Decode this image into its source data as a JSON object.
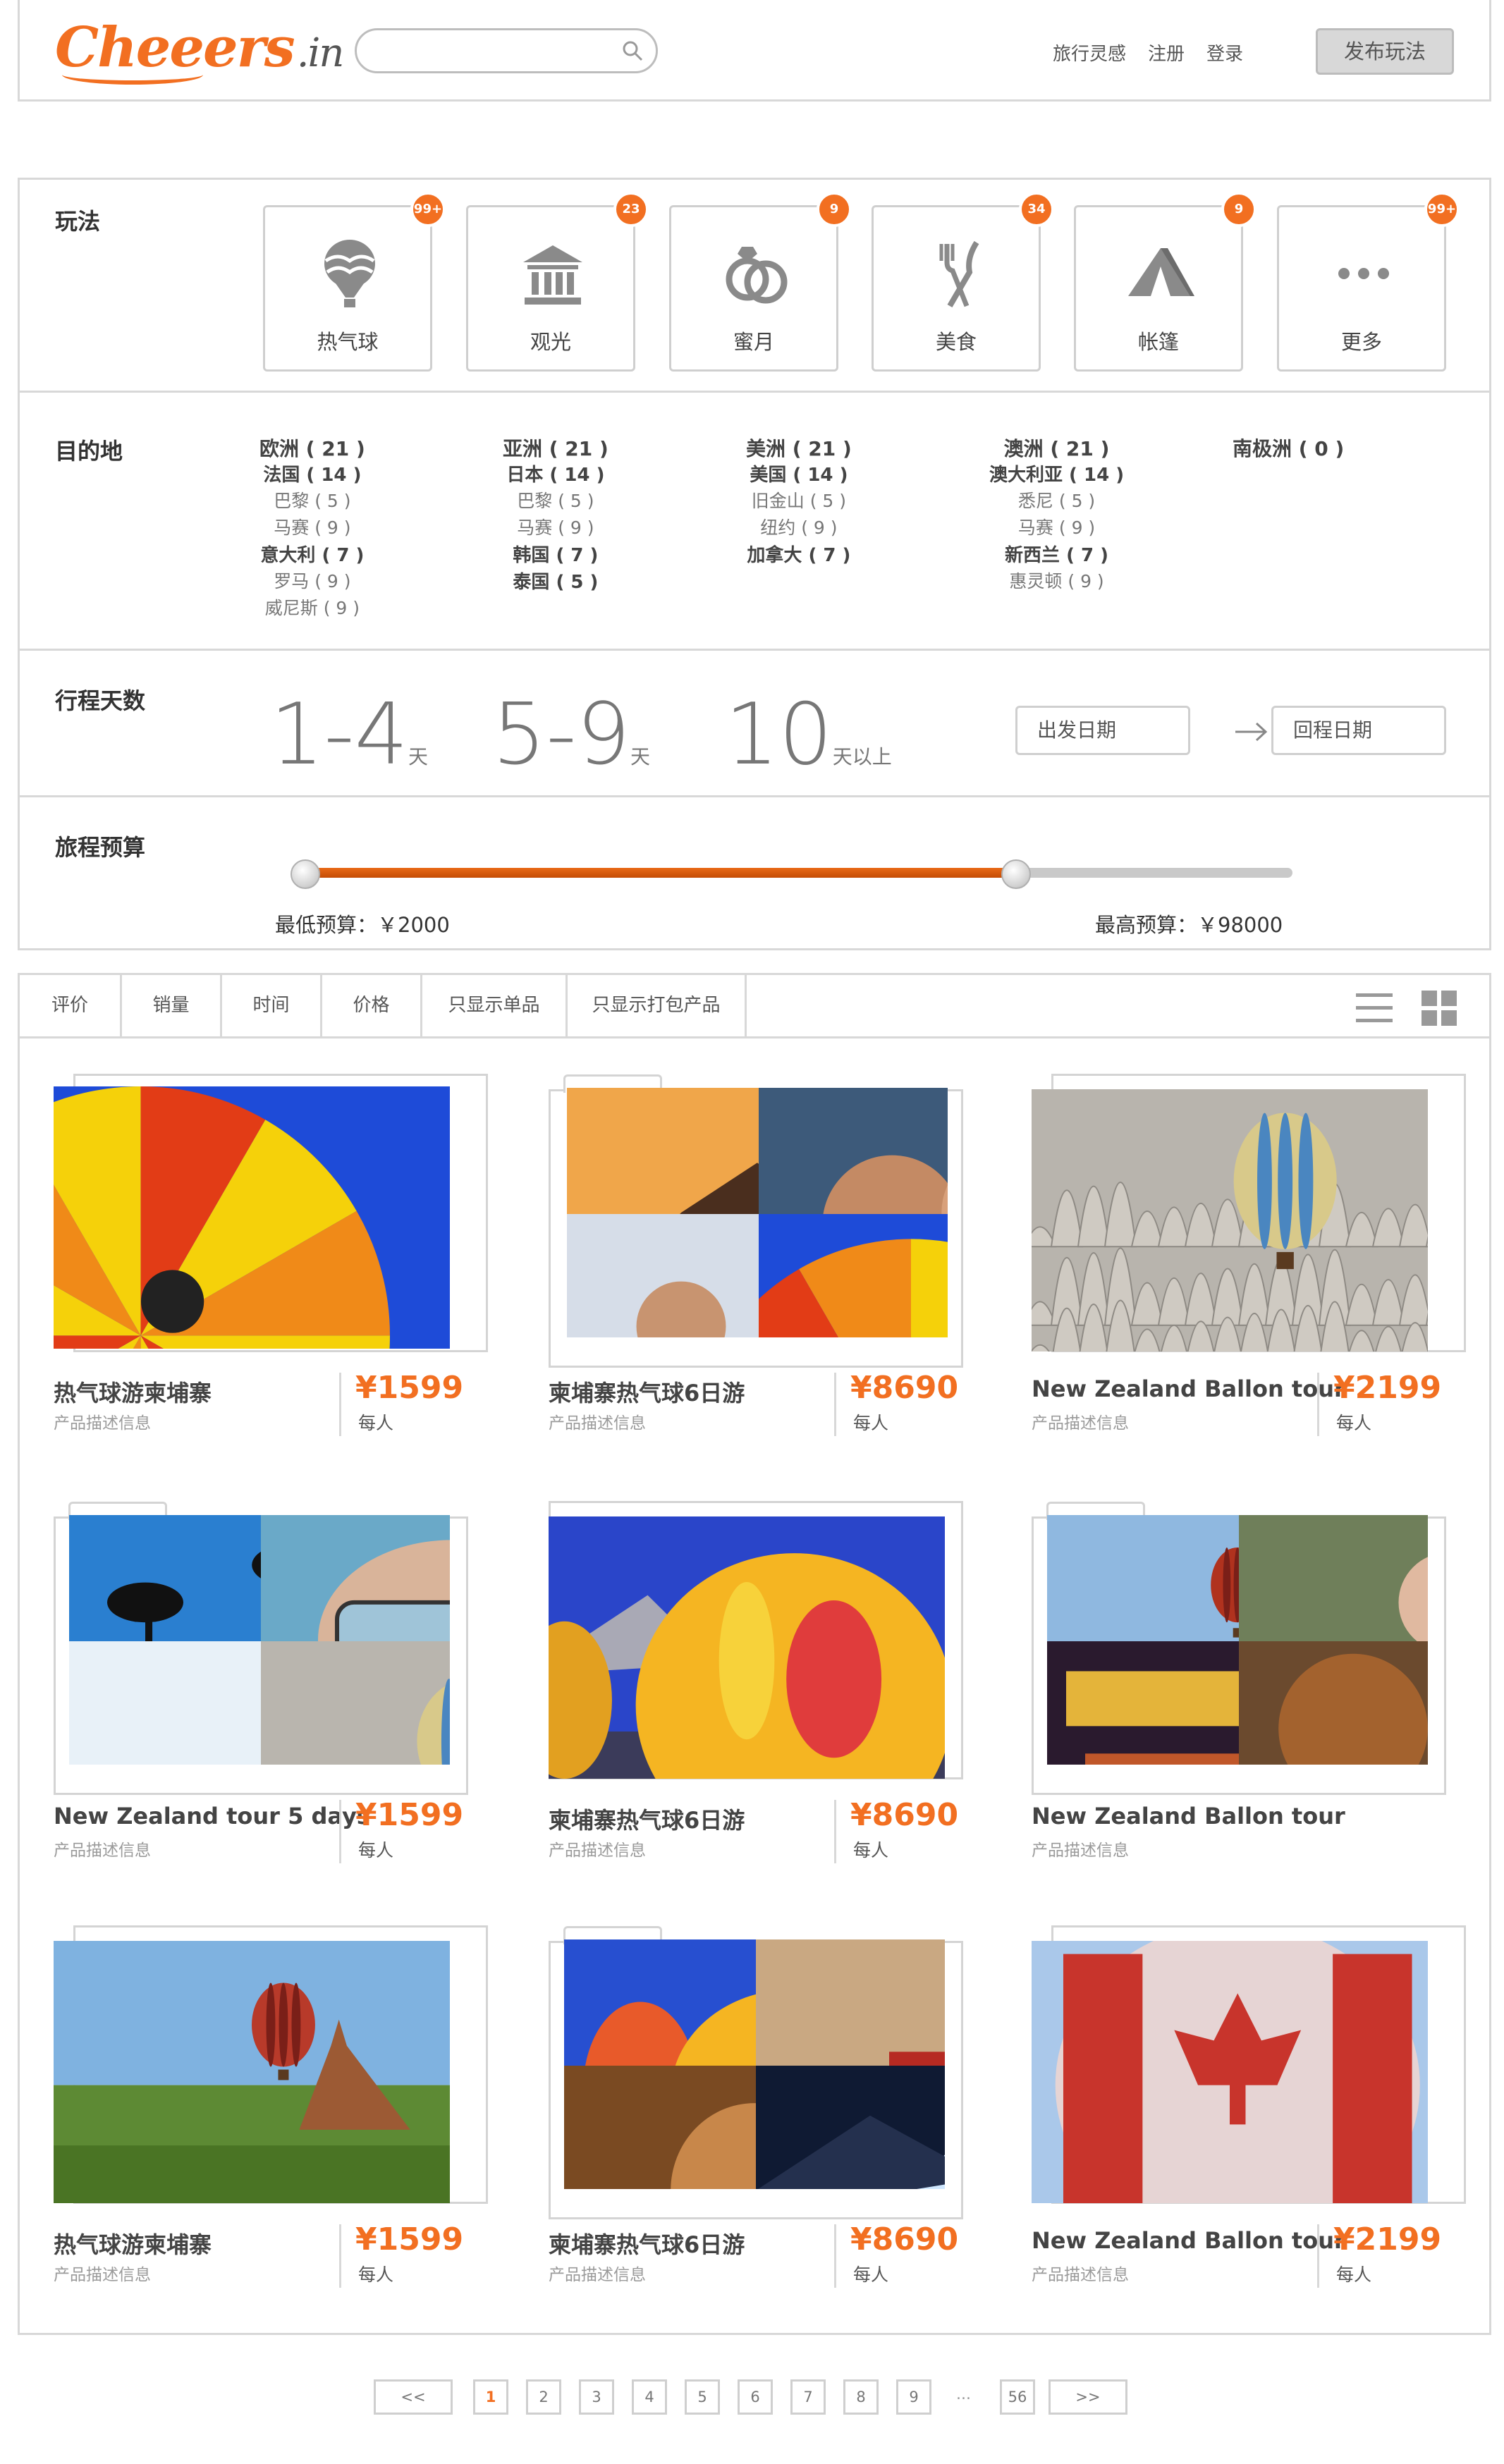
{
  "header": {
    "logo": "Cheeers",
    "logo_suffix": ".in",
    "search_placeholder": "",
    "nav": [
      "旅行灵感",
      "注册",
      "登录"
    ],
    "publish_label": "发布玩法"
  },
  "filters": {
    "play": {
      "label": "玩法",
      "items": [
        {
          "label": "热气球",
          "badge": "99+",
          "icon": "hot-air-balloon-icon"
        },
        {
          "label": "观光",
          "badge": "23",
          "icon": "landmark-icon"
        },
        {
          "label": "蜜月",
          "badge": "9",
          "icon": "rings-icon"
        },
        {
          "label": "美食",
          "badge": "34",
          "icon": "fork-knife-icon"
        },
        {
          "label": "帐篷",
          "badge": "9",
          "icon": "tent-icon"
        },
        {
          "label": "更多",
          "badge": "99+",
          "icon": "more-icon"
        }
      ]
    },
    "destination": {
      "label": "目的地",
      "continents": [
        {
          "name": "欧洲 ( 21 )",
          "items": [
            {
              "text": "法国 ( 14 )",
              "level": 1
            },
            {
              "text": "巴黎 ( 5 )",
              "level": 2
            },
            {
              "text": "马赛 ( 9 )",
              "level": 2
            },
            {
              "text": "意大利 ( 7 )",
              "level": 1
            },
            {
              "text": "罗马 ( 9 )",
              "level": 2
            },
            {
              "text": "威尼斯 ( 9 )",
              "level": 2
            }
          ]
        },
        {
          "name": "亚洲 ( 21 )",
          "items": [
            {
              "text": "日本 ( 14 )",
              "level": 1
            },
            {
              "text": "巴黎 ( 5 )",
              "level": 2
            },
            {
              "text": "马赛 ( 9 )",
              "level": 2
            },
            {
              "text": "韩国 ( 7 )",
              "level": 1
            },
            {
              "text": "泰国 ( 5 )",
              "level": 1
            }
          ]
        },
        {
          "name": "美洲 ( 21 )",
          "items": [
            {
              "text": "美国 ( 14 )",
              "level": 1
            },
            {
              "text": "旧金山 ( 5 )",
              "level": 2
            },
            {
              "text": "纽约 ( 9 )",
              "level": 2
            },
            {
              "text": "加拿大 ( 7 )",
              "level": 1
            }
          ]
        },
        {
          "name": "澳洲 ( 21 )",
          "items": [
            {
              "text": "澳大利亚 ( 14 )",
              "level": 1
            },
            {
              "text": "悉尼 ( 5 )",
              "level": 2
            },
            {
              "text": "马赛 ( 9 )",
              "level": 2
            },
            {
              "text": "新西兰 ( 7 )",
              "level": 1
            },
            {
              "text": "惠灵顿 ( 9 )",
              "level": 2
            }
          ]
        },
        {
          "name": "南极洲 ( 0 )",
          "items": []
        }
      ]
    },
    "days": {
      "label": "行程天数",
      "options": [
        {
          "value": "1-4",
          "suffix": "天"
        },
        {
          "value": "5-9",
          "suffix": "天"
        },
        {
          "value": "10",
          "suffix": "天以上"
        }
      ],
      "depart_placeholder": "出发日期",
      "return_placeholder": "回程日期"
    },
    "budget": {
      "label": "旅程预算",
      "min_label": "最低预算：￥2000",
      "max_label": "最高预算：￥98000",
      "min_fraction": 0,
      "max_fraction": 0.72
    }
  },
  "sort": {
    "tabs": [
      "评价",
      "销量",
      "时间",
      "价格",
      "只显示单品",
      "只显示打包产品"
    ]
  },
  "products": [
    {
      "title": "热气球游柬埔寨",
      "desc": "产品描述信息",
      "price": "¥1599",
      "per": "每人",
      "image": "balloon-closeup"
    },
    {
      "title": "柬埔寨热气球6日游",
      "desc": "产品描述信息",
      "price": "¥8690",
      "per": "每人",
      "image": "collage-honeymoon"
    },
    {
      "title": "New Zealand Ballon tour",
      "desc": "产品描述信息",
      "price": "¥2199",
      "per": "每人",
      "image": "balloon-over-rocks"
    },
    {
      "title": "New Zealand tour 5 days",
      "desc": "产品描述信息",
      "price": "¥1599",
      "per": "每人",
      "image": "collage-beach"
    },
    {
      "title": "柬埔寨热气球6日游",
      "desc": "产品描述信息",
      "price": "¥8690",
      "per": "每人",
      "image": "balloons-inflating"
    },
    {
      "title": "New Zealand Ballon tour",
      "desc": "产品描述信息",
      "price": "",
      "per": "",
      "image": "collage-temple-food"
    },
    {
      "title": "热气球游柬埔寨",
      "desc": "产品描述信息",
      "price": "¥1599",
      "per": "每人",
      "image": "balloon-temple"
    },
    {
      "title": "柬埔寨热气球6日游",
      "desc": "产品描述信息",
      "price": "¥8690",
      "per": "每人",
      "image": "collage-adventure"
    },
    {
      "title": "New Zealand Ballon tour",
      "desc": "产品描述信息",
      "price": "¥2199",
      "per": "每人",
      "image": "canada-balloon"
    }
  ],
  "pagination": {
    "prev": "<<",
    "pages": [
      "1",
      "2",
      "3",
      "4",
      "5",
      "6",
      "7",
      "8",
      "9"
    ],
    "ellipsis": "...",
    "last": "56",
    "next": ">>",
    "current": "1"
  },
  "colors": {
    "accent": "#f26f21",
    "border": "#d8d8d8",
    "text": "#333333",
    "muted": "#9a9a9a"
  }
}
